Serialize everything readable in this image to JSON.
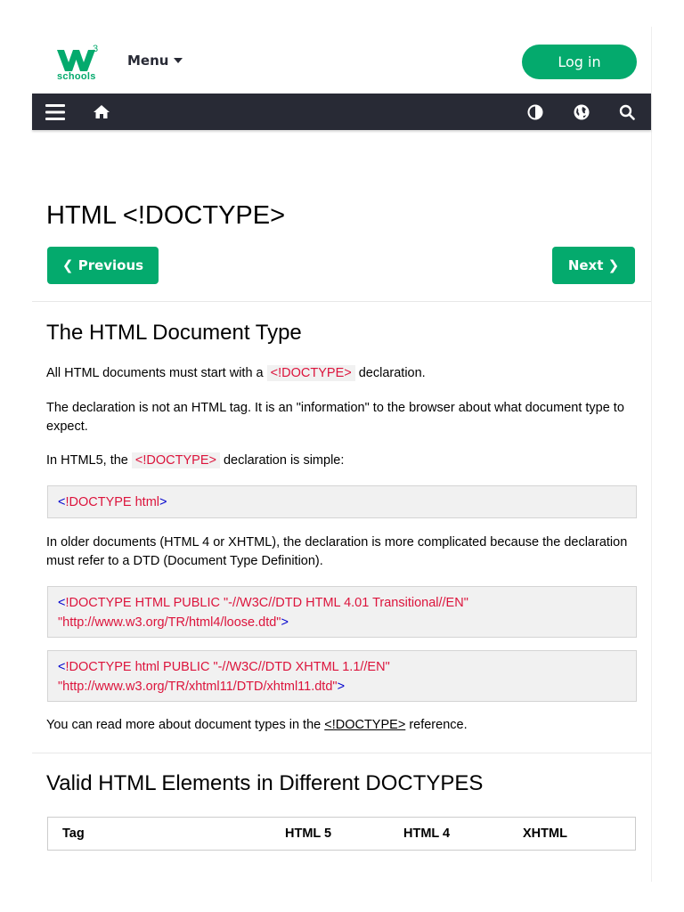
{
  "header": {
    "logo_text": "schools",
    "logo_superscript": "3",
    "menu_label": "Menu",
    "login_label": "Log in"
  },
  "navbar": {
    "icons": [
      "hamburger-icon",
      "home-icon",
      "contrast-icon",
      "globe-icon",
      "search-icon"
    ]
  },
  "colors": {
    "brand_green": "#04AA6D",
    "navbar_bg": "#282a35",
    "code_red": "#dc143c",
    "code_blue": "#0000cd"
  },
  "page": {
    "title": "HTML <!DOCTYPE>",
    "previous_label": "❮ Previous",
    "next_label": "Next ❯"
  },
  "section1": {
    "heading": "The HTML Document Type",
    "p1_before": "All HTML documents must start with a ",
    "p1_code": "<!DOCTYPE>",
    "p1_after": " declaration.",
    "p2": "The declaration is not an HTML tag. It is an \"information\" to the browser about what document type to expect.",
    "p3_before": "In HTML5, the ",
    "p3_code": "<!DOCTYPE>",
    "p3_after": " declaration is simple:",
    "code1_open": "<",
    "code1_body": "!DOCTYPE html",
    "code1_close": ">",
    "p4": "In older documents (HTML 4 or XHTML), the declaration is more complicated because the declaration must refer to a DTD (Document Type Definition).",
    "code2_open": "<",
    "code2_line1": "!DOCTYPE HTML PUBLIC \"-//W3C//DTD HTML 4.01 Transitional//EN\"",
    "code2_line2": "\"http://www.w3.org/TR/html4/loose.dtd\"",
    "code2_close": ">",
    "code3_open": "<",
    "code3_line1": "!DOCTYPE html PUBLIC \"-//W3C//DTD XHTML 1.1//EN\"",
    "code3_line2": "\"http://www.w3.org/TR/xhtml11/DTD/xhtml11.dtd\"",
    "code3_close": ">",
    "p5_before": "You can read more about document types in the ",
    "p5_link": "<!DOCTYPE>",
    "p5_after": " reference."
  },
  "section2": {
    "heading": "Valid HTML Elements in Different DOCTYPES",
    "table_headers": [
      "Tag",
      "HTML 5",
      "HTML 4",
      "XHTML"
    ]
  }
}
